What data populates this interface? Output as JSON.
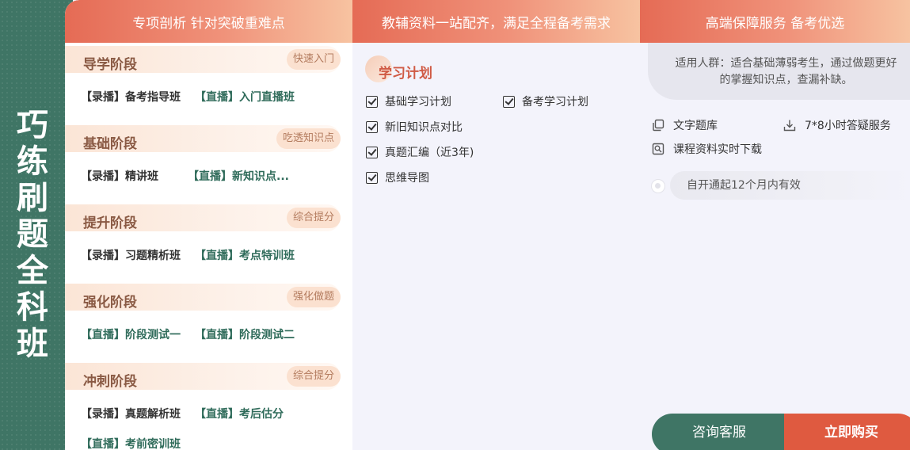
{
  "side_title": "巧练刷题全科班",
  "headers": [
    "专项剖析 针对突破重难点",
    "教辅资料一站配齐，满足全程备考需求",
    "高端保障服务 备考优选"
  ],
  "stages": [
    {
      "name": "导学阶段",
      "tag": "快速入门",
      "courses": [
        "【录播】备考指导班",
        "【直播】入门直播班"
      ]
    },
    {
      "name": "基础阶段",
      "tag": "吃透知识点",
      "courses": [
        "【录播】精讲班",
        "【直播】新知识点..."
      ]
    },
    {
      "name": "提升阶段",
      "tag": "综合提分",
      "courses": [
        "【录播】习题精析班",
        "【直播】考点特训班"
      ]
    },
    {
      "name": "强化阶段",
      "tag": "强化做题",
      "courses": [
        "【直播】阶段测试一",
        "【直播】阶段测试二"
      ]
    },
    {
      "name": "冲刺阶段",
      "tag": "综合提分",
      "courses": [
        "【录播】真题解析班",
        "【直播】考后估分"
      ]
    }
  ],
  "extra_course": "【直播】考前密训班",
  "plan": {
    "title": "学习计划",
    "items": [
      "基础学习计划",
      "备考学习计划",
      "新旧知识点对比",
      "真题汇编（近3年)",
      "思维导图"
    ]
  },
  "audience": "适用人群：适合基础薄弱考生，通过做题更好的掌握知识点，查漏补缺。",
  "services": [
    "文字题库",
    "7*8小时答疑服务",
    "课程资料实时下载"
  ],
  "validity": "自开通起12个月内有效",
  "buttons": {
    "consult": "咨询客服",
    "buy": "立即购买"
  },
  "icons": [
    "file-copy-icon",
    "download-icon",
    "document-search-icon",
    "radio-icon"
  ],
  "colors": {
    "green": "#3f7565",
    "orange": "#e56b55",
    "buy": "#df5a40"
  }
}
